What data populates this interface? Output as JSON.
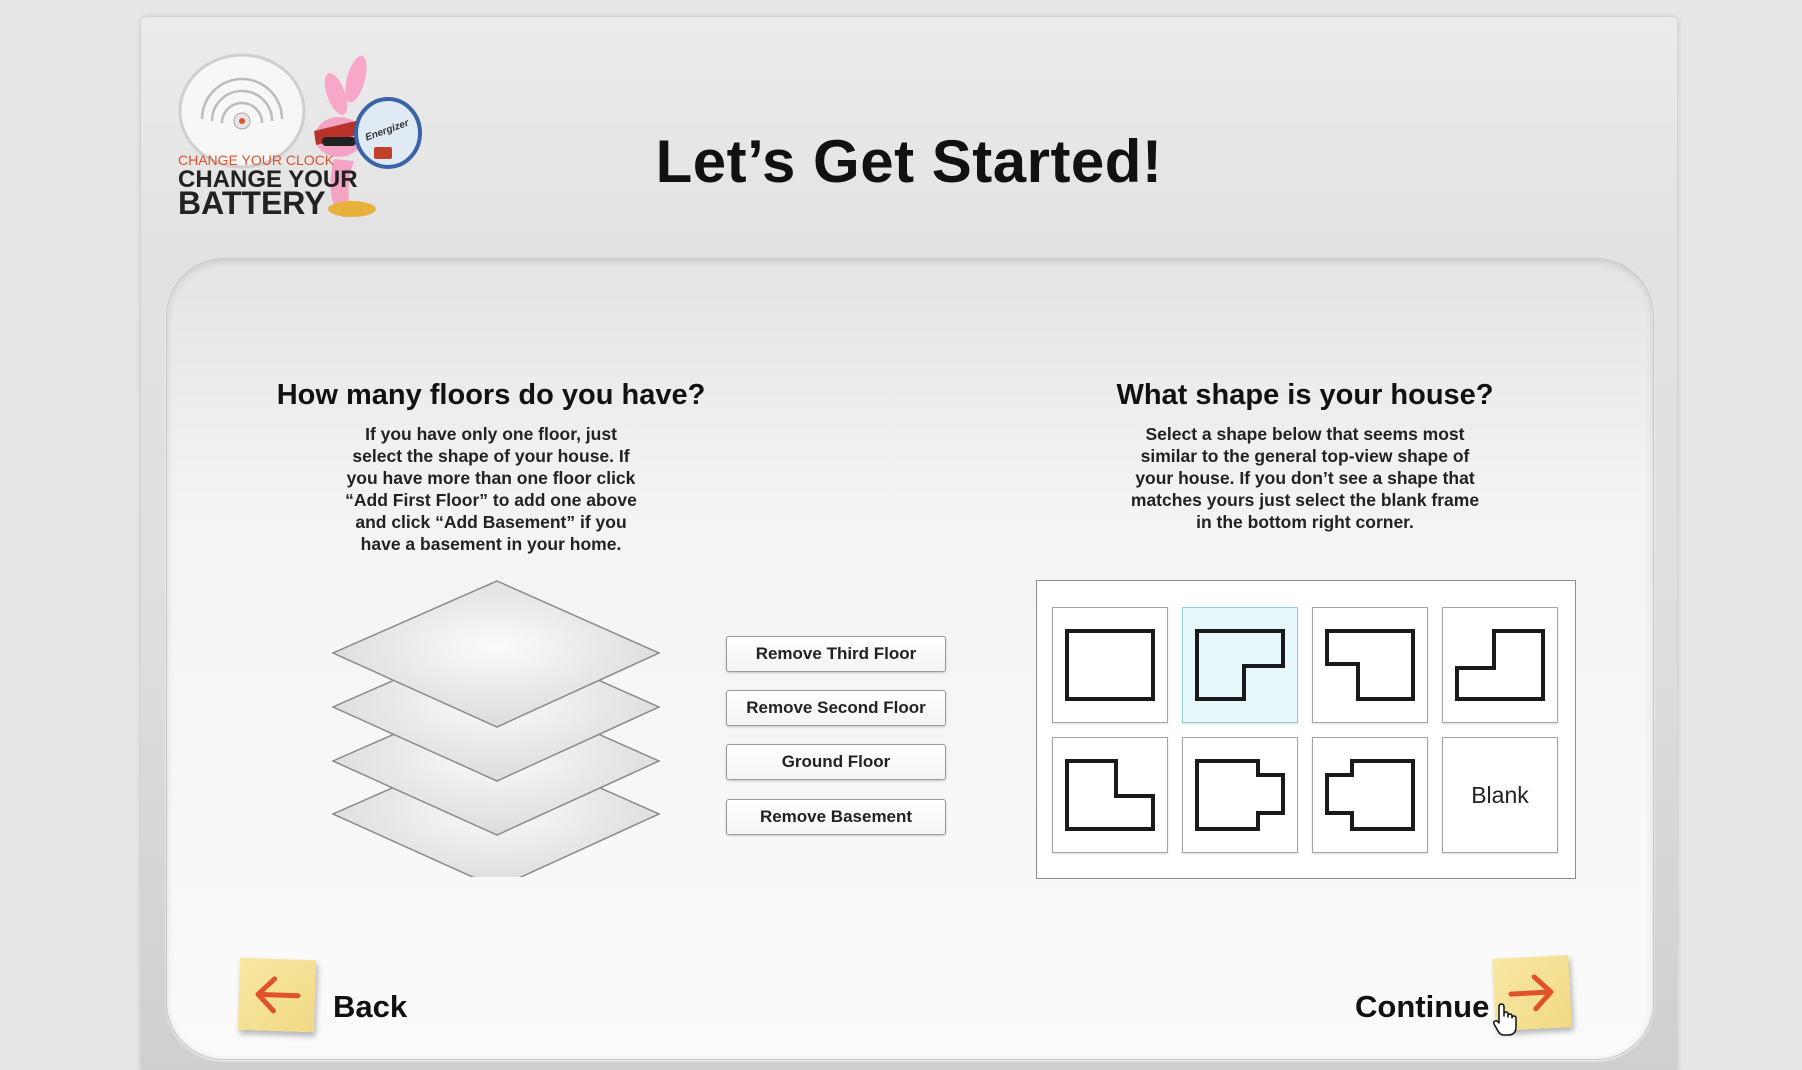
{
  "header": {
    "title": "Let’s Get Started!",
    "logo": {
      "line1": "CHANGE YOUR CLOCK",
      "line2": "CHANGE YOUR",
      "line3": "BATTERY",
      "badge": "Energizer"
    }
  },
  "floors": {
    "title": "How many floors do you have?",
    "description": "If you have only one floor, just select the shape of your house. If you have more than one floor click “Add First Floor” to add one above and click “Add Basement” if you have a basement in your home.",
    "buttons": [
      "Remove Third Floor",
      "Remove Second Floor",
      "Ground Floor",
      "Remove Basement"
    ]
  },
  "shapes": {
    "title": "What shape is your house?",
    "description": "Select a shape below that seems most similar to the general top-view shape of your house. If you don’t see a shape that matches yours just select the blank frame in the bottom right corner.",
    "options": [
      "rectangle-shape-icon",
      "notch-bottom-right-shape-icon",
      "notch-bottom-left-shape-icon",
      "notch-top-left-shape-icon",
      "notch-top-right-shape-icon",
      "bump-right-shape-icon",
      "bump-left-shape-icon",
      "Blank"
    ],
    "selected_index": 1,
    "blank_label": "Blank"
  },
  "nav": {
    "back_label": "Back",
    "continue_label": "Continue",
    "back_icon": "arrow-left-icon",
    "continue_icon": "arrow-right-icon",
    "arrow_color": "#e0532a",
    "note_color": "#f5e291"
  }
}
